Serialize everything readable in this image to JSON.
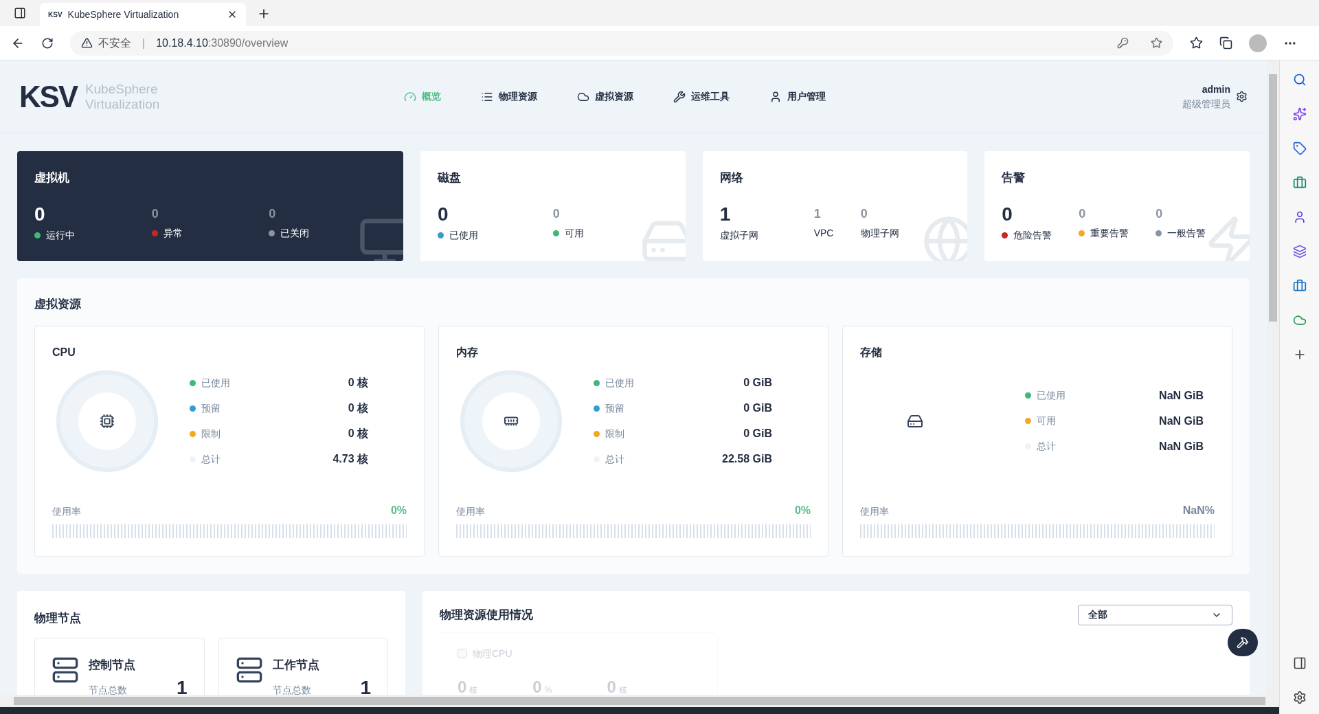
{
  "browser": {
    "tab_title": "KubeSphere Virtualization",
    "favicon": "KSV",
    "security": "不安全",
    "separator": "|",
    "url_host": "10.18.4.10",
    "url_rest": ":30890/overview"
  },
  "header": {
    "logo": "KSV",
    "brand_line1": "KubeSphere",
    "brand_line2": "Virtualization",
    "nav": [
      {
        "label": "概览",
        "selected": true
      },
      {
        "label": "物理资源",
        "selected": false
      },
      {
        "label": "虚拟资源",
        "selected": false
      },
      {
        "label": "运维工具",
        "selected": false
      },
      {
        "label": "用户管理",
        "selected": false
      }
    ],
    "user": {
      "name": "admin",
      "role": "超级管理员"
    }
  },
  "summary_cards": [
    {
      "title": "虚拟机",
      "dark": true,
      "stats": [
        {
          "value": "0",
          "label": "运行中",
          "color": "#3eb87a"
        },
        {
          "value": "0",
          "label": "异常",
          "color": "#ca2621"
        },
        {
          "value": "0",
          "label": "已关闭",
          "color": "#8a95a3"
        }
      ]
    },
    {
      "title": "磁盘",
      "dark": false,
      "stats": [
        {
          "value": "0",
          "label": "已使用",
          "color": "#329dce"
        },
        {
          "value": "0",
          "label": "可用",
          "color": "#3eb87a"
        }
      ]
    },
    {
      "title": "网络",
      "dark": false,
      "stats": [
        {
          "value": "1",
          "label": "虚拟子网"
        },
        {
          "value": "1",
          "label": "VPC"
        },
        {
          "value": "0",
          "label": "物理子网"
        }
      ]
    },
    {
      "title": "告警",
      "dark": false,
      "stats": [
        {
          "value": "0",
          "label": "危险告警",
          "color": "#ca2621"
        },
        {
          "value": "0",
          "label": "重要告警",
          "color": "#f5a623"
        },
        {
          "value": "0",
          "label": "一般告警",
          "color": "#8a95a3"
        }
      ]
    }
  ],
  "virtual_resources": {
    "title": "虚拟资源",
    "panels": [
      {
        "title": "CPU",
        "kind": "ring",
        "rows": [
          {
            "label": "已使用",
            "value": "0 核",
            "color": "#3eb87a"
          },
          {
            "label": "预留",
            "value": "0 核",
            "color": "#329dce"
          },
          {
            "label": "限制",
            "value": "0 核",
            "color": "#f5a623"
          },
          {
            "label": "总计",
            "value": "4.73 核",
            "color": "#eff3f7"
          }
        ],
        "usage_label": "使用率",
        "usage": "0%",
        "usage_ok": true
      },
      {
        "title": "内存",
        "kind": "ring",
        "rows": [
          {
            "label": "已使用",
            "value": "0 GiB",
            "color": "#3eb87a"
          },
          {
            "label": "预留",
            "value": "0 GiB",
            "color": "#329dce"
          },
          {
            "label": "限制",
            "value": "0 GiB",
            "color": "#f5a623"
          },
          {
            "label": "总计",
            "value": "22.58 GiB",
            "color": "#eff3f7"
          }
        ],
        "usage_label": "使用率",
        "usage": "0%",
        "usage_ok": true
      },
      {
        "title": "存储",
        "kind": "plain",
        "rows": [
          {
            "label": "已使用",
            "value": "NaN GiB",
            "color": "#3eb87a"
          },
          {
            "label": "可用",
            "value": "NaN GiB",
            "color": "#f5a623"
          },
          {
            "label": "总计",
            "value": "NaN GiB",
            "color": "#eff3f7"
          }
        ],
        "usage_label": "使用率",
        "usage": "NaN%",
        "usage_ok": false
      }
    ]
  },
  "physical_nodes": {
    "title": "物理节点",
    "nodes": [
      {
        "name": "控制节点",
        "label": "节点总数",
        "count": "1"
      },
      {
        "name": "工作节点",
        "label": "节点总数",
        "count": "1"
      }
    ]
  },
  "physical_usage": {
    "title": "物理资源使用情况",
    "filter": "全部",
    "card": {
      "checkbox_label": "物理CPU",
      "checked": false,
      "values": [
        "0",
        "0",
        "0"
      ],
      "units": [
        "核",
        "%",
        "核"
      ]
    }
  }
}
